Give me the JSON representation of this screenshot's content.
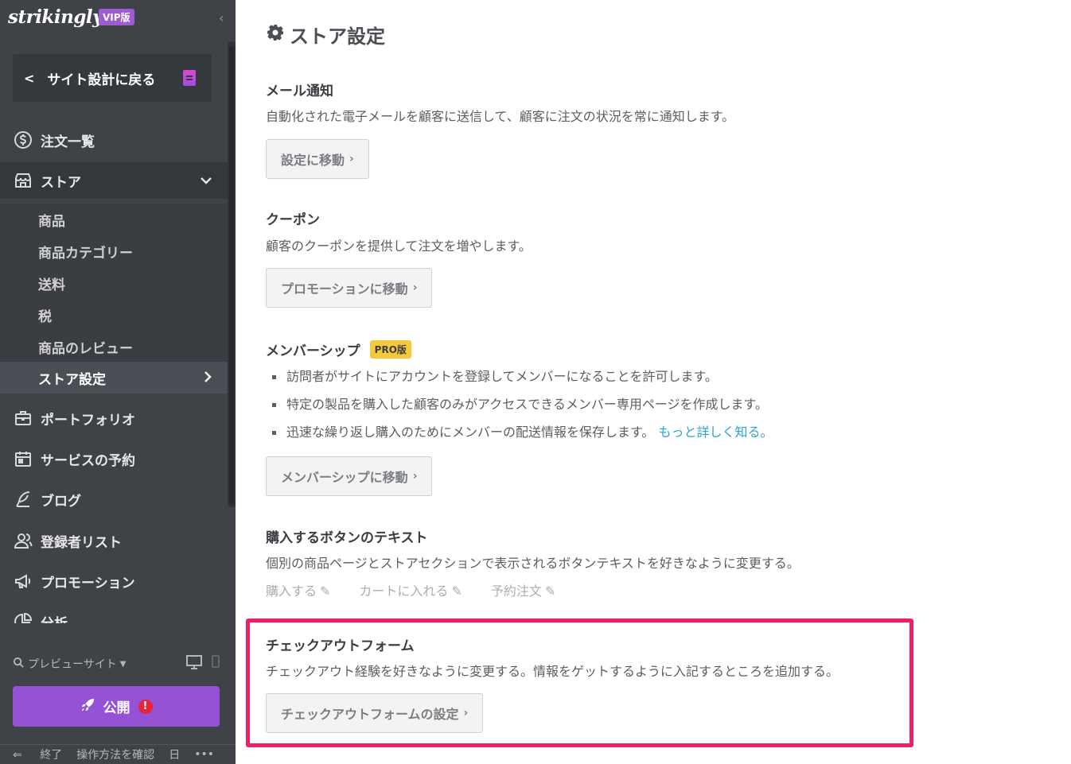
{
  "sidebar": {
    "brand": "strikingly",
    "vip_badge": "VIP版",
    "collapse_icon": "‹",
    "back_label": "サイト設計に戻る",
    "nav": [
      {
        "label": "注文一覧",
        "icon": "dollar-circle-icon"
      },
      {
        "label": "ストア",
        "icon": "store-icon"
      },
      {
        "label": "ポートフォリオ",
        "icon": "briefcase-icon"
      },
      {
        "label": "サービスの予約",
        "icon": "calendar-icon"
      },
      {
        "label": "ブログ",
        "icon": "feather-pen-icon"
      },
      {
        "label": "登録者リスト",
        "icon": "users-icon"
      },
      {
        "label": "プロモーション",
        "icon": "megaphone-icon"
      },
      {
        "label": "分析",
        "icon": "pie-chart-icon"
      }
    ],
    "store_sub": [
      {
        "label": "商品"
      },
      {
        "label": "商品カテゴリー"
      },
      {
        "label": "送料"
      },
      {
        "label": "税"
      },
      {
        "label": "商品のレビュー"
      },
      {
        "label": "ストア設定"
      }
    ],
    "preview_label": "プレビューサイト",
    "publish_label": "公開",
    "publish_alert": "!",
    "footer": {
      "exit": "終了",
      "howto": "操作方法を確認",
      "lang": "日",
      "more": "•••"
    }
  },
  "main": {
    "page_title": "ストア設定",
    "sections": {
      "email": {
        "title": "メール通知",
        "desc": "自動化された電子メールを顧客に送信して、顧客に注文の状況を常に通知します。",
        "button": "設定に移動"
      },
      "coupon": {
        "title": "クーポン",
        "desc": "顧客のクーポンを提供して注文を増やします。",
        "button": "プロモーションに移動"
      },
      "membership": {
        "title": "メンバーシップ",
        "badge": "PRO版",
        "bullets": [
          "訪問者がサイトにアカウントを登録してメンバーになることを許可します。",
          "特定の製品を購入した顧客のみがアクセスできるメンバー専用ページを作成します。",
          "迅速な繰り返し購入のためにメンバーの配送情報を保存します。"
        ],
        "learn_more": "もっと詳しく知る。",
        "button": "メンバーシップに移動"
      },
      "buy_button": {
        "title": "購入するボタンのテキスト",
        "desc": "個別の商品ページとストアセクションで表示されるボタンテキストを好きなように変更する。",
        "links": [
          "購入する",
          "カートに入れる",
          "予約注文"
        ]
      },
      "checkout": {
        "title": "チェックアウトフォーム",
        "desc": "チェックアウト経験を好きなように変更する。情報をゲットするように入記するところを追加する。",
        "button": "チェックアウトフォームの設定"
      }
    }
  },
  "colors": {
    "sidebar_bg": "#3f4247",
    "publish": "#9452d4",
    "highlight": "#ee1f62",
    "pro_badge": "#f5c93b",
    "link": "#2aa3c9"
  }
}
